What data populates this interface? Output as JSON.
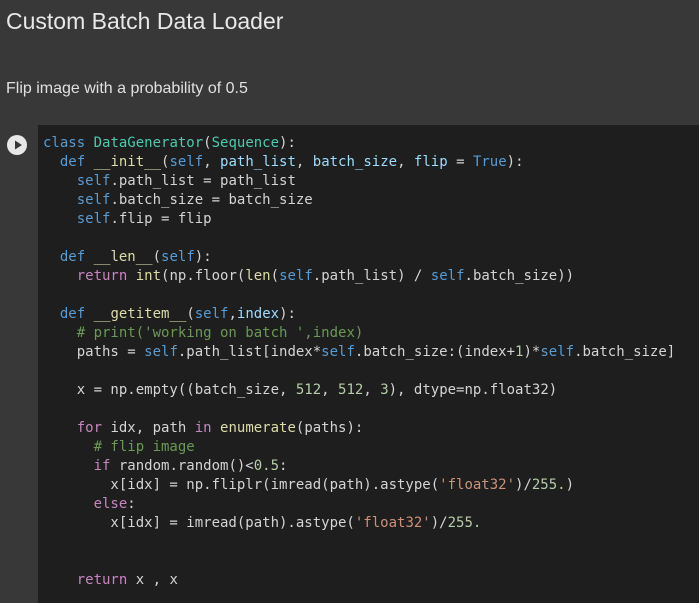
{
  "text_cell": {
    "heading": "Custom Batch Data Loader",
    "paragraph": "Flip image with a probability of 0.5"
  },
  "code_cell": {
    "run_icon": "play-icon",
    "lines": [
      [
        [
          "kw",
          "class"
        ],
        [
          "t",
          " "
        ],
        [
          "cls",
          "DataGenerator"
        ],
        [
          "t",
          "("
        ],
        [
          "cls",
          "Sequence"
        ],
        [
          "t",
          "):"
        ]
      ],
      [
        [
          "t",
          "  "
        ],
        [
          "kw",
          "def"
        ],
        [
          "t",
          " "
        ],
        [
          "fn",
          "__init__"
        ],
        [
          "t",
          "("
        ],
        [
          "self",
          "self"
        ],
        [
          "t",
          ", "
        ],
        [
          "var",
          "path_list"
        ],
        [
          "t",
          ", "
        ],
        [
          "var",
          "batch_size"
        ],
        [
          "t",
          ", "
        ],
        [
          "var",
          "flip"
        ],
        [
          "t",
          " = "
        ],
        [
          "kw",
          "True"
        ],
        [
          "t",
          "):"
        ]
      ],
      [
        [
          "t",
          "    "
        ],
        [
          "self",
          "self"
        ],
        [
          "t",
          ".path_list = path_list"
        ]
      ],
      [
        [
          "t",
          "    "
        ],
        [
          "self",
          "self"
        ],
        [
          "t",
          ".batch_size = batch_size"
        ]
      ],
      [
        [
          "t",
          "    "
        ],
        [
          "self",
          "self"
        ],
        [
          "t",
          ".flip = flip"
        ]
      ],
      [],
      [
        [
          "t",
          "  "
        ],
        [
          "kw",
          "def"
        ],
        [
          "t",
          " "
        ],
        [
          "fn",
          "__len__"
        ],
        [
          "t",
          "("
        ],
        [
          "self",
          "self"
        ],
        [
          "t",
          "):"
        ]
      ],
      [
        [
          "t",
          "    "
        ],
        [
          "ctl",
          "return"
        ],
        [
          "t",
          " "
        ],
        [
          "fn",
          "int"
        ],
        [
          "t",
          "(np.floor("
        ],
        [
          "fn",
          "len"
        ],
        [
          "t",
          "("
        ],
        [
          "self",
          "self"
        ],
        [
          "t",
          ".path_list) / "
        ],
        [
          "self",
          "self"
        ],
        [
          "t",
          ".batch_size))"
        ]
      ],
      [],
      [
        [
          "t",
          "  "
        ],
        [
          "kw",
          "def"
        ],
        [
          "t",
          " "
        ],
        [
          "fn",
          "__getitem__"
        ],
        [
          "t",
          "("
        ],
        [
          "self",
          "self"
        ],
        [
          "t",
          ","
        ],
        [
          "var",
          "index"
        ],
        [
          "t",
          "):"
        ]
      ],
      [
        [
          "t",
          "    "
        ],
        [
          "cm",
          "# print('working on batch ',index)"
        ]
      ],
      [
        [
          "t",
          "    paths = "
        ],
        [
          "self",
          "self"
        ],
        [
          "t",
          ".path_list[index*"
        ],
        [
          "self",
          "self"
        ],
        [
          "t",
          ".batch_size:(index+"
        ],
        [
          "num",
          "1"
        ],
        [
          "t",
          ")*"
        ],
        [
          "self",
          "self"
        ],
        [
          "t",
          ".batch_size]"
        ]
      ],
      [],
      [
        [
          "t",
          "    x = np.empty((batch_size, "
        ],
        [
          "num",
          "512"
        ],
        [
          "t",
          ", "
        ],
        [
          "num",
          "512"
        ],
        [
          "t",
          ", "
        ],
        [
          "num",
          "3"
        ],
        [
          "t",
          "), dtype=np.float32)"
        ]
      ],
      [],
      [
        [
          "t",
          "    "
        ],
        [
          "ctl",
          "for"
        ],
        [
          "t",
          " idx, path "
        ],
        [
          "ctl",
          "in"
        ],
        [
          "t",
          " "
        ],
        [
          "fn",
          "enumerate"
        ],
        [
          "t",
          "(paths):"
        ]
      ],
      [
        [
          "t",
          "      "
        ],
        [
          "cm",
          "# flip image"
        ]
      ],
      [
        [
          "t",
          "      "
        ],
        [
          "ctl",
          "if"
        ],
        [
          "t",
          " random.random()<"
        ],
        [
          "num",
          "0.5"
        ],
        [
          "t",
          ":"
        ]
      ],
      [
        [
          "t",
          "        x[idx] = np.fliplr(imread(path).astype("
        ],
        [
          "str",
          "'float32'"
        ],
        [
          "t",
          ")/"
        ],
        [
          "num",
          "255."
        ],
        [
          "t",
          ")"
        ]
      ],
      [
        [
          "t",
          "      "
        ],
        [
          "ctl",
          "else"
        ],
        [
          "t",
          ":"
        ]
      ],
      [
        [
          "t",
          "        x[idx] = imread(path).astype("
        ],
        [
          "str",
          "'float32'"
        ],
        [
          "t",
          ")/"
        ],
        [
          "num",
          "255."
        ]
      ],
      [],
      [],
      [
        [
          "t",
          "    "
        ],
        [
          "ctl",
          "return"
        ],
        [
          "t",
          " x , x"
        ]
      ]
    ]
  }
}
